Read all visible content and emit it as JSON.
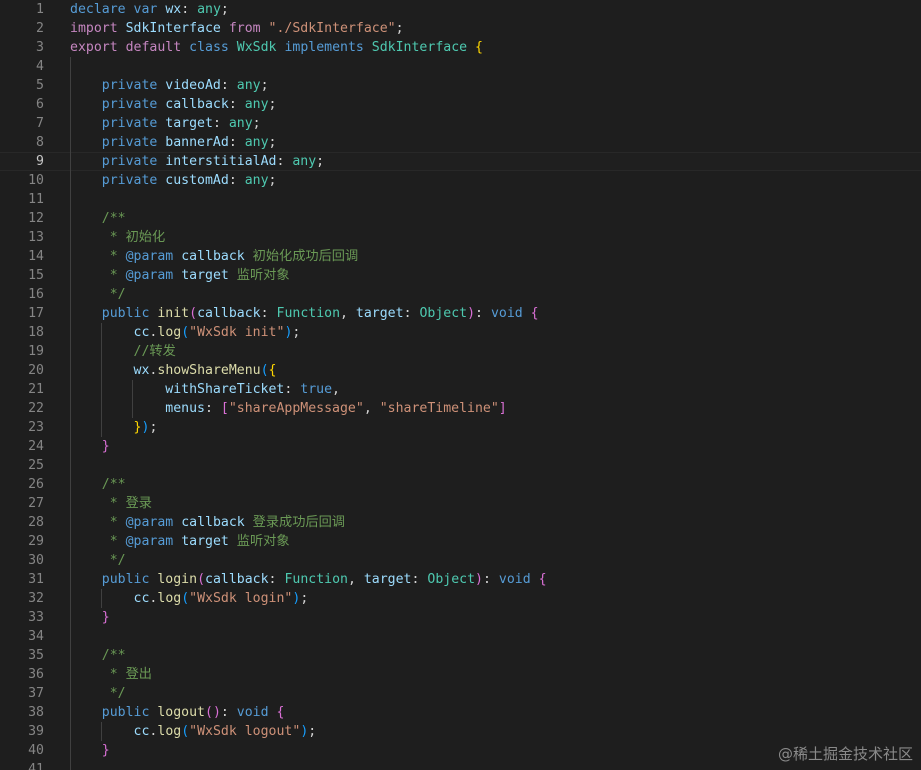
{
  "editor": {
    "current_line": "9",
    "watermark": "@稀土掘金技术社区",
    "lines": [
      {
        "n": "1",
        "tokens": [
          [
            "kw",
            "declare"
          ],
          [
            "pl",
            " "
          ],
          [
            "kw",
            "var"
          ],
          [
            "pl",
            " "
          ],
          [
            "var",
            "wx"
          ],
          [
            "pl",
            ": "
          ],
          [
            "typ",
            "any"
          ],
          [
            "pl",
            ";"
          ]
        ]
      },
      {
        "n": "2",
        "tokens": [
          [
            "kwc",
            "import"
          ],
          [
            "pl",
            " "
          ],
          [
            "var",
            "SdkInterface"
          ],
          [
            "pl",
            " "
          ],
          [
            "kwc",
            "from"
          ],
          [
            "pl",
            " "
          ],
          [
            "str",
            "\"./SdkInterface\""
          ],
          [
            "pl",
            ";"
          ]
        ]
      },
      {
        "n": "3",
        "tokens": [
          [
            "kwc",
            "export"
          ],
          [
            "pl",
            " "
          ],
          [
            "kwc",
            "default"
          ],
          [
            "pl",
            " "
          ],
          [
            "kw",
            "class"
          ],
          [
            "pl",
            " "
          ],
          [
            "typ",
            "WxSdk"
          ],
          [
            "pl",
            " "
          ],
          [
            "kw",
            "implements"
          ],
          [
            "pl",
            " "
          ],
          [
            "typ",
            "SdkInterface"
          ],
          [
            "pl",
            " "
          ],
          [
            "br1",
            "{"
          ]
        ]
      },
      {
        "n": "4",
        "tokens": []
      },
      {
        "n": "5",
        "tokens": [
          [
            "pl",
            "    "
          ],
          [
            "kw",
            "private"
          ],
          [
            "pl",
            " "
          ],
          [
            "var",
            "videoAd"
          ],
          [
            "pl",
            ": "
          ],
          [
            "typ",
            "any"
          ],
          [
            "pl",
            ";"
          ]
        ]
      },
      {
        "n": "6",
        "tokens": [
          [
            "pl",
            "    "
          ],
          [
            "kw",
            "private"
          ],
          [
            "pl",
            " "
          ],
          [
            "var",
            "callback"
          ],
          [
            "pl",
            ": "
          ],
          [
            "typ",
            "any"
          ],
          [
            "pl",
            ";"
          ]
        ]
      },
      {
        "n": "7",
        "tokens": [
          [
            "pl",
            "    "
          ],
          [
            "kw",
            "private"
          ],
          [
            "pl",
            " "
          ],
          [
            "var",
            "target"
          ],
          [
            "pl",
            ": "
          ],
          [
            "typ",
            "any"
          ],
          [
            "pl",
            ";"
          ]
        ]
      },
      {
        "n": "8",
        "tokens": [
          [
            "pl",
            "    "
          ],
          [
            "kw",
            "private"
          ],
          [
            "pl",
            " "
          ],
          [
            "var",
            "bannerAd"
          ],
          [
            "pl",
            ": "
          ],
          [
            "typ",
            "any"
          ],
          [
            "pl",
            ";"
          ]
        ]
      },
      {
        "n": "9",
        "tokens": [
          [
            "pl",
            "    "
          ],
          [
            "kw",
            "private"
          ],
          [
            "pl",
            " "
          ],
          [
            "var",
            "interstitialAd"
          ],
          [
            "pl",
            ": "
          ],
          [
            "typ",
            "any"
          ],
          [
            "pl",
            ";"
          ]
        ]
      },
      {
        "n": "10",
        "tokens": [
          [
            "pl",
            "    "
          ],
          [
            "kw",
            "private"
          ],
          [
            "pl",
            " "
          ],
          [
            "var",
            "customAd"
          ],
          [
            "pl",
            ": "
          ],
          [
            "typ",
            "any"
          ],
          [
            "pl",
            ";"
          ]
        ]
      },
      {
        "n": "11",
        "tokens": []
      },
      {
        "n": "12",
        "tokens": [
          [
            "pl",
            "    "
          ],
          [
            "cm",
            "/**"
          ]
        ]
      },
      {
        "n": "13",
        "tokens": [
          [
            "pl",
            "     "
          ],
          [
            "cm",
            "* 初始化"
          ]
        ]
      },
      {
        "n": "14",
        "tokens": [
          [
            "pl",
            "     "
          ],
          [
            "cm",
            "* "
          ],
          [
            "kw",
            "@param"
          ],
          [
            "pl",
            " "
          ],
          [
            "var",
            "callback"
          ],
          [
            "cm",
            " 初始化成功后回调"
          ]
        ]
      },
      {
        "n": "15",
        "tokens": [
          [
            "pl",
            "     "
          ],
          [
            "cm",
            "* "
          ],
          [
            "kw",
            "@param"
          ],
          [
            "pl",
            " "
          ],
          [
            "var",
            "target"
          ],
          [
            "cm",
            " 监听对象"
          ]
        ]
      },
      {
        "n": "16",
        "tokens": [
          [
            "pl",
            "     "
          ],
          [
            "cm",
            "*/"
          ]
        ]
      },
      {
        "n": "17",
        "tokens": [
          [
            "pl",
            "    "
          ],
          [
            "kw",
            "public"
          ],
          [
            "pl",
            " "
          ],
          [
            "fn",
            "init"
          ],
          [
            "br2",
            "("
          ],
          [
            "var",
            "callback"
          ],
          [
            "pl",
            ": "
          ],
          [
            "typ",
            "Function"
          ],
          [
            "pl",
            ", "
          ],
          [
            "var",
            "target"
          ],
          [
            "pl",
            ": "
          ],
          [
            "typ",
            "Object"
          ],
          [
            "br2",
            ")"
          ],
          [
            "pl",
            ": "
          ],
          [
            "kw",
            "void"
          ],
          [
            "pl",
            " "
          ],
          [
            "br2",
            "{"
          ]
        ]
      },
      {
        "n": "18",
        "tokens": [
          [
            "pl",
            "        "
          ],
          [
            "var",
            "cc"
          ],
          [
            "pl",
            "."
          ],
          [
            "fn",
            "log"
          ],
          [
            "br3",
            "("
          ],
          [
            "str",
            "\"WxSdk init\""
          ],
          [
            "br3",
            ")"
          ],
          [
            "pl",
            ";"
          ]
        ]
      },
      {
        "n": "19",
        "tokens": [
          [
            "pl",
            "        "
          ],
          [
            "cm",
            "//转发"
          ]
        ]
      },
      {
        "n": "20",
        "tokens": [
          [
            "pl",
            "        "
          ],
          [
            "var",
            "wx"
          ],
          [
            "pl",
            "."
          ],
          [
            "fn",
            "showShareMenu"
          ],
          [
            "br3",
            "("
          ],
          [
            "br1",
            "{"
          ]
        ]
      },
      {
        "n": "21",
        "tokens": [
          [
            "pl",
            "            "
          ],
          [
            "var",
            "withShareTicket"
          ],
          [
            "pl",
            ": "
          ],
          [
            "kw",
            "true"
          ],
          [
            "pl",
            ","
          ]
        ]
      },
      {
        "n": "22",
        "tokens": [
          [
            "pl",
            "            "
          ],
          [
            "var",
            "menus"
          ],
          [
            "pl",
            ": "
          ],
          [
            "br2",
            "["
          ],
          [
            "str",
            "\"shareAppMessage\""
          ],
          [
            "pl",
            ", "
          ],
          [
            "str",
            "\"shareTimeline\""
          ],
          [
            "br2",
            "]"
          ]
        ]
      },
      {
        "n": "23",
        "tokens": [
          [
            "pl",
            "        "
          ],
          [
            "br1",
            "}"
          ],
          [
            "br3",
            ")"
          ],
          [
            "pl",
            ";"
          ]
        ]
      },
      {
        "n": "24",
        "tokens": [
          [
            "pl",
            "    "
          ],
          [
            "br2",
            "}"
          ]
        ]
      },
      {
        "n": "25",
        "tokens": []
      },
      {
        "n": "26",
        "tokens": [
          [
            "pl",
            "    "
          ],
          [
            "cm",
            "/**"
          ]
        ]
      },
      {
        "n": "27",
        "tokens": [
          [
            "pl",
            "     "
          ],
          [
            "cm",
            "* 登录"
          ]
        ]
      },
      {
        "n": "28",
        "tokens": [
          [
            "pl",
            "     "
          ],
          [
            "cm",
            "* "
          ],
          [
            "kw",
            "@param"
          ],
          [
            "pl",
            " "
          ],
          [
            "var",
            "callback"
          ],
          [
            "cm",
            " 登录成功后回调"
          ]
        ]
      },
      {
        "n": "29",
        "tokens": [
          [
            "pl",
            "     "
          ],
          [
            "cm",
            "* "
          ],
          [
            "kw",
            "@param"
          ],
          [
            "pl",
            " "
          ],
          [
            "var",
            "target"
          ],
          [
            "cm",
            " 监听对象"
          ]
        ]
      },
      {
        "n": "30",
        "tokens": [
          [
            "pl",
            "     "
          ],
          [
            "cm",
            "*/"
          ]
        ]
      },
      {
        "n": "31",
        "tokens": [
          [
            "pl",
            "    "
          ],
          [
            "kw",
            "public"
          ],
          [
            "pl",
            " "
          ],
          [
            "fn",
            "login"
          ],
          [
            "br2",
            "("
          ],
          [
            "var",
            "callback"
          ],
          [
            "pl",
            ": "
          ],
          [
            "typ",
            "Function"
          ],
          [
            "pl",
            ", "
          ],
          [
            "var",
            "target"
          ],
          [
            "pl",
            ": "
          ],
          [
            "typ",
            "Object"
          ],
          [
            "br2",
            ")"
          ],
          [
            "pl",
            ": "
          ],
          [
            "kw",
            "void"
          ],
          [
            "pl",
            " "
          ],
          [
            "br2",
            "{"
          ]
        ]
      },
      {
        "n": "32",
        "tokens": [
          [
            "pl",
            "        "
          ],
          [
            "var",
            "cc"
          ],
          [
            "pl",
            "."
          ],
          [
            "fn",
            "log"
          ],
          [
            "br3",
            "("
          ],
          [
            "str",
            "\"WxSdk login\""
          ],
          [
            "br3",
            ")"
          ],
          [
            "pl",
            ";"
          ]
        ]
      },
      {
        "n": "33",
        "tokens": [
          [
            "pl",
            "    "
          ],
          [
            "br2",
            "}"
          ]
        ]
      },
      {
        "n": "34",
        "tokens": []
      },
      {
        "n": "35",
        "tokens": [
          [
            "pl",
            "    "
          ],
          [
            "cm",
            "/**"
          ]
        ]
      },
      {
        "n": "36",
        "tokens": [
          [
            "pl",
            "     "
          ],
          [
            "cm",
            "* 登出"
          ]
        ]
      },
      {
        "n": "37",
        "tokens": [
          [
            "pl",
            "     "
          ],
          [
            "cm",
            "*/"
          ]
        ]
      },
      {
        "n": "38",
        "tokens": [
          [
            "pl",
            "    "
          ],
          [
            "kw",
            "public"
          ],
          [
            "pl",
            " "
          ],
          [
            "fn",
            "logout"
          ],
          [
            "br2",
            "("
          ],
          [
            "br2",
            ")"
          ],
          [
            "pl",
            ": "
          ],
          [
            "kw",
            "void"
          ],
          [
            "pl",
            " "
          ],
          [
            "br2",
            "{"
          ]
        ]
      },
      {
        "n": "39",
        "tokens": [
          [
            "pl",
            "        "
          ],
          [
            "var",
            "cc"
          ],
          [
            "pl",
            "."
          ],
          [
            "fn",
            "log"
          ],
          [
            "br3",
            "("
          ],
          [
            "str",
            "\"WxSdk logout\""
          ],
          [
            "br3",
            ")"
          ],
          [
            "pl",
            ";"
          ]
        ]
      },
      {
        "n": "40",
        "tokens": [
          [
            "pl",
            "    "
          ],
          [
            "br2",
            "}"
          ]
        ]
      },
      {
        "n": "41",
        "tokens": []
      }
    ]
  }
}
